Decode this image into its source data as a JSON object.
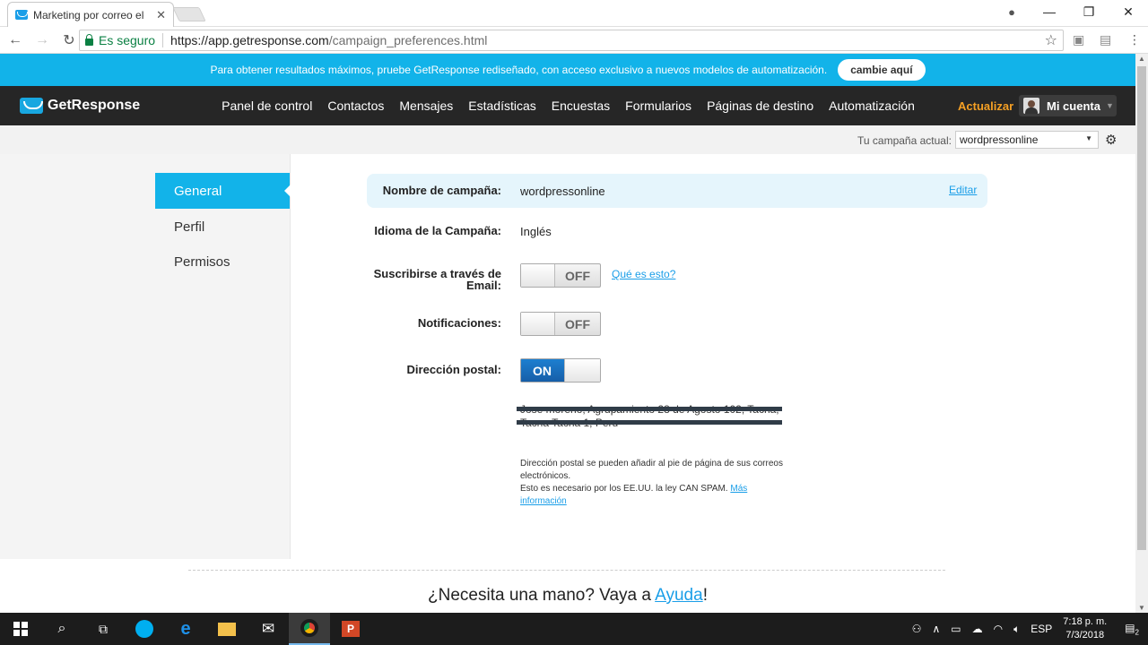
{
  "browser": {
    "tab_title": "Marketing por correo ele",
    "tab_close": "✕",
    "secure_label": "Es seguro",
    "url_host": "https://app.getresponse.com",
    "url_path": "/campaign_preferences.html"
  },
  "banner": {
    "text": "Para obtener resultados máximos, pruebe GetResponse rediseñado, con acceso exclusivo a nuevos modelos de automatización.",
    "button": "cambie aquí"
  },
  "nav": {
    "logo": "GetResponse",
    "items": [
      "Panel de control",
      "Contactos",
      "Mensajes",
      "Estadísticas",
      "Encuestas",
      "Formularios",
      "Páginas de destino",
      "Automatización"
    ],
    "upgrade": "Actualizar",
    "account": "Mi cuenta"
  },
  "campaign_bar": {
    "label": "Tu campaña actual:",
    "selected": "wordpressonline"
  },
  "sidebar": {
    "items": [
      "General",
      "Perfil",
      "Permisos"
    ]
  },
  "settings": {
    "campaign_name_label": "Nombre de campaña:",
    "campaign_name_value": "wordpressonline",
    "edit_link": "Editar",
    "language_label": "Idioma de la Campaña:",
    "language_value": "Inglés",
    "subscribe_label": "Suscribirse a través de Email:",
    "subscribe_state": "OFF",
    "whats_this": "Qué es esto?",
    "notifications_label": "Notificaciones:",
    "notifications_state": "OFF",
    "postal_label": "Dirección postal:",
    "postal_state": "ON",
    "address_line1": "Jose moreno, Agrupamiento 28 de Agosto 102, Tacna,",
    "address_line2": "Tacna Tacna 1, Peru",
    "note_line1": "Dirección postal se pueden añadir al pie de página de sus correos electrónicos.",
    "note_line2": "Esto es necesario por los EE.UU. la ley CAN SPAM.",
    "more_info": "Más información"
  },
  "help": {
    "prefix": "¿Necesita una mano? Vaya a ",
    "link": "Ayuda",
    "suffix": "!"
  },
  "taskbar": {
    "lang": "ESP",
    "time": "7:18 p. m.",
    "date": "7/3/2018",
    "notif_count": "2"
  }
}
